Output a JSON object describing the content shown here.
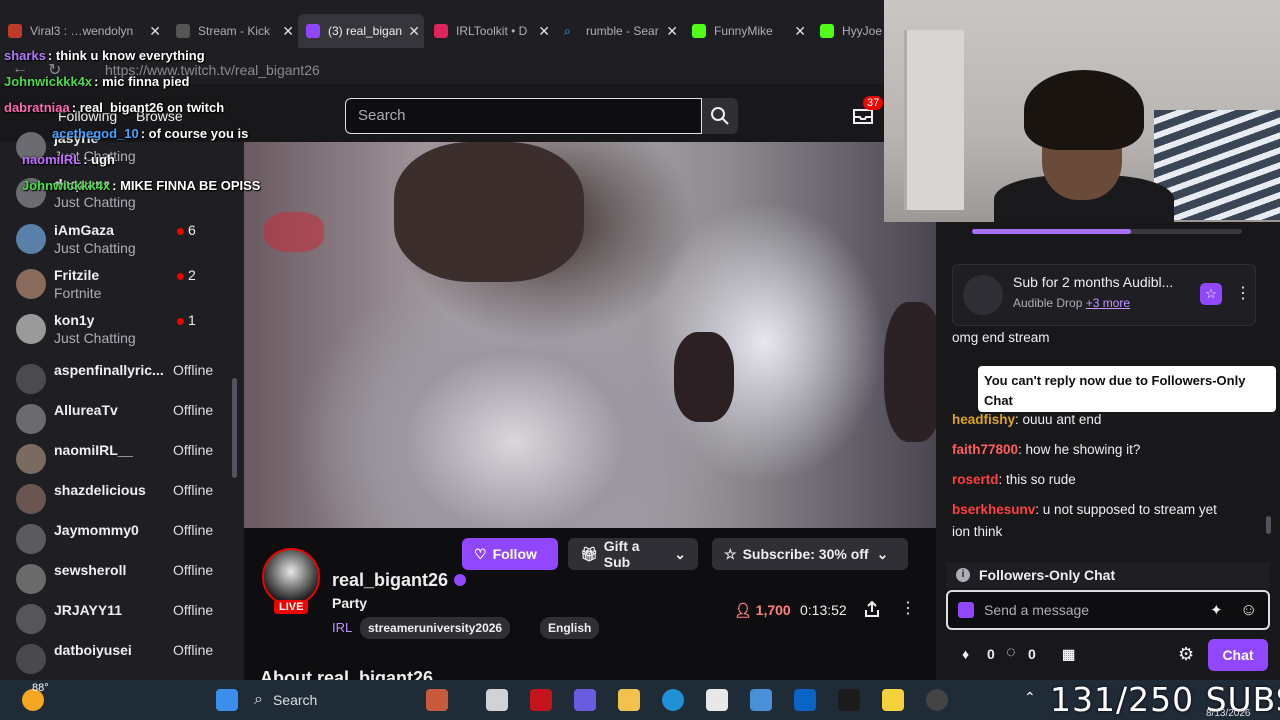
{
  "browser": {
    "tabs": [
      {
        "label": "Viral3 : …wendolyn"
      },
      {
        "label": "Stream - Kick"
      },
      {
        "label": "(3) real_bigan"
      },
      {
        "label": "IRLToolkit • D"
      },
      {
        "label": "rumble - Sear"
      },
      {
        "label": "FunnyMike"
      },
      {
        "label": "HyyJoe"
      }
    ],
    "url": "https://www.twitch.tv/real_bigant26"
  },
  "topnav": {
    "following": "Following",
    "browse": "Browse",
    "search_placeholder": "Search",
    "inbox_count": "37"
  },
  "sidebar": {
    "channels": [
      {
        "name": "jasyrio",
        "game": "Just Chatting",
        "status": "",
        "viewers": ""
      },
      {
        "name": "daquanr",
        "game": "Just Chatting",
        "status": "",
        "viewers": ""
      },
      {
        "name": "iAmGaza",
        "game": "Just Chatting",
        "status": "",
        "viewers": "6"
      },
      {
        "name": "Fritzile",
        "game": "Fortnite",
        "status": "",
        "viewers": "2"
      },
      {
        "name": "kon1y",
        "game": "Just Chatting",
        "status": "",
        "viewers": "1"
      },
      {
        "name": "aspenfinallyric...",
        "game": "",
        "status": "Offline",
        "viewers": ""
      },
      {
        "name": "AllureaTv",
        "game": "",
        "status": "Offline",
        "viewers": ""
      },
      {
        "name": "naomiIRL__",
        "game": "",
        "status": "Offline",
        "viewers": ""
      },
      {
        "name": "shazdelicious",
        "game": "",
        "status": "Offline",
        "viewers": ""
      },
      {
        "name": "Jaymommy0",
        "game": "",
        "status": "Offline",
        "viewers": ""
      },
      {
        "name": "sewsheroll",
        "game": "",
        "status": "Offline",
        "viewers": ""
      },
      {
        "name": "JRJAYY11",
        "game": "",
        "status": "Offline",
        "viewers": ""
      },
      {
        "name": "datboiyusei",
        "game": "",
        "status": "Offline",
        "viewers": ""
      }
    ]
  },
  "overlay_chat": [
    {
      "user": "sharks",
      "msg": ": think u know everything",
      "color": "#b47bff"
    },
    {
      "user": "Johnwickkk4x",
      "msg": ": mic finna pied",
      "color": "#4ddb4d"
    },
    {
      "user": "dabratniaa",
      "msg": ": real_bigant26 on twitch",
      "color": "#ff69b4"
    },
    {
      "user": "acethegod_10",
      "msg": ": of course you is",
      "color": "#4aa3ff"
    },
    {
      "user": "naomiIRL",
      "msg": ": ugh",
      "color": "#c070ff"
    },
    {
      "user": "Johnwickkk4x",
      "msg": ": MIKE FINNA BE OPISS",
      "color": "#4ddb4d"
    }
  ],
  "channel": {
    "name": "real_bigant26",
    "live_label": "LIVE",
    "title": "Party",
    "category": "IRL",
    "tags": [
      "streameruniversity2026",
      "English"
    ],
    "follow_label": "Follow",
    "gift_label": "Gift a Sub",
    "subscribe_label": "Subscribe: 30% off",
    "viewers": "1,700",
    "uptime": "0:13:52",
    "about": "About real_bigant26"
  },
  "chat": {
    "drop_progress": 0.59,
    "drop_title": "Sub for 2 months Audibl...",
    "drop_source": "Audible Drop",
    "drop_more": "+3 more",
    "messages": [
      {
        "user": "",
        "text": "omg end stream",
        "color": "#ff5f5f"
      },
      {
        "user": "headfishy",
        "text": ": ouuu ant end",
        "color": "#daa520"
      },
      {
        "user": "faith77800",
        "text": ": how he showing it?",
        "color": "#ff5f5f"
      },
      {
        "user": "rosertd",
        "text": ": this so rude",
        "color": "#ff4040"
      },
      {
        "user": "bserkhesunv",
        "text": ": u not supposed to stream yet",
        "color": "#ff4040"
      },
      {
        "user": "",
        "text": "ion think",
        "color": "#efeff1"
      }
    ],
    "tooltip": "You can't reply now due to Followers-Only Chat",
    "followers_only": "Followers-Only Chat",
    "placeholder": "Send a message",
    "points_a": "0",
    "points_b": "0",
    "chat_button": "Chat"
  },
  "taskbar": {
    "weather": "88°",
    "search": "Search"
  },
  "overlay_subs": "131/250 SUBS",
  "date": "8/13/2026"
}
